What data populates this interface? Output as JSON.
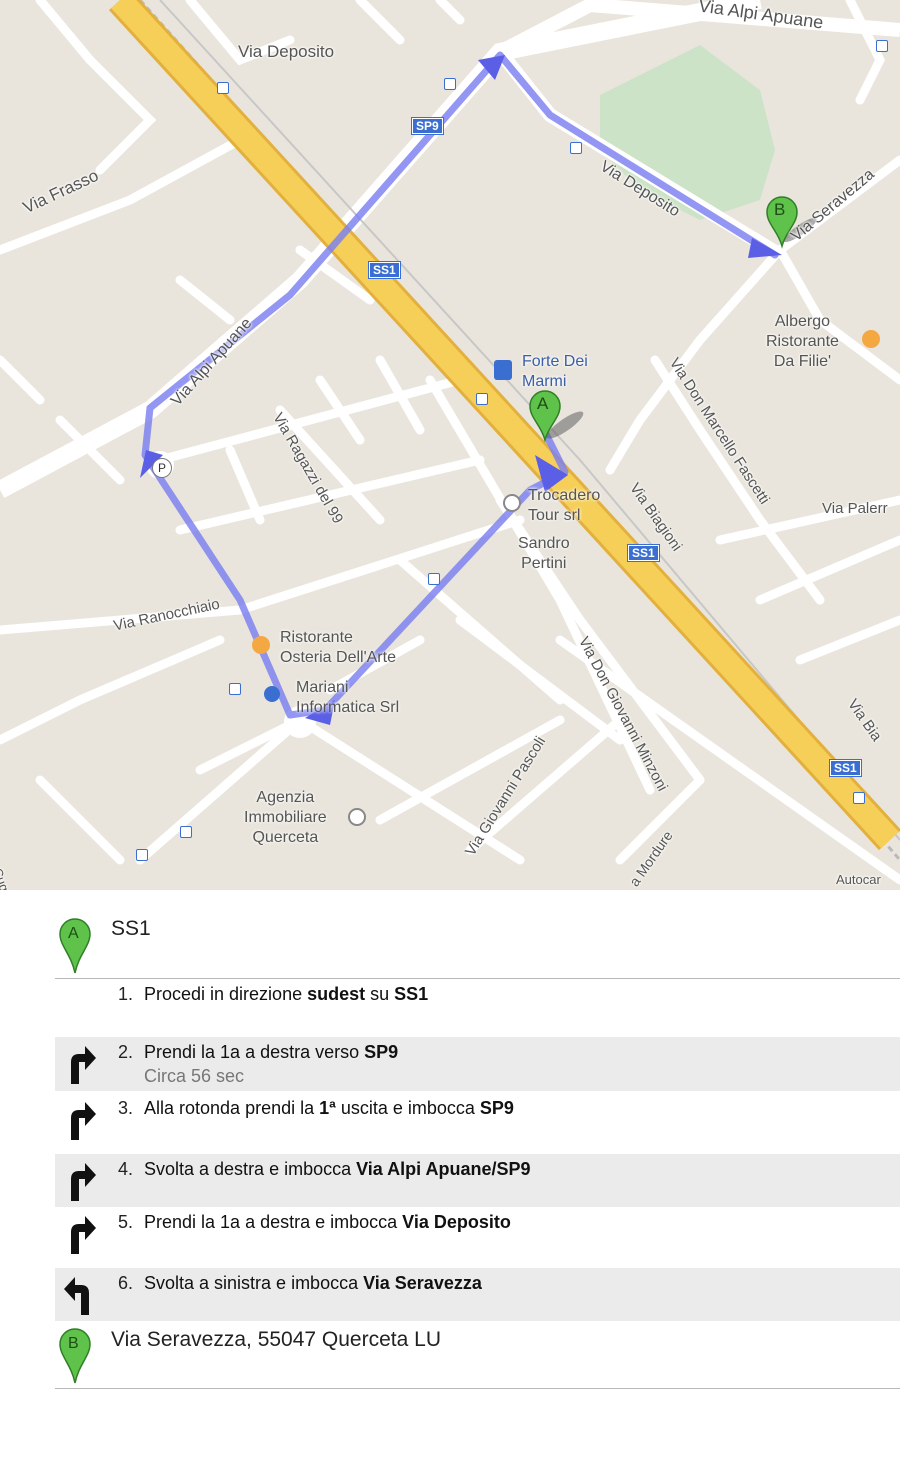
{
  "map": {
    "road_labels": {
      "via_alpi_apuane_top": "Via Alpi Apuane",
      "via_deposito_top": "Via Deposito",
      "via_frasso": "Via Frasso",
      "via_deposito_route": "Via Deposito",
      "via_seravezza": "Via Seravezza",
      "via_alpi_apuane_route": "Via Alpi Apuane",
      "via_ragazzi": "Via Ragazzi del 99",
      "via_don_marcello": "Via Don Marcello Fascetti",
      "via_biagioni": "Via Biagioni",
      "via_palermo": "Via Palerr",
      "via_ranocchiaio": "Via Ranocchiaio",
      "via_don_giovanni": "Via Don Giovanni Minzoni",
      "via_giovanni_pascoli": "Via Giovanni Pascoli",
      "via_biagioni_right": "Via Bia",
      "via_mordure": "a Mordure",
      "cugni": "Cugni",
      "autocar": "Autocar"
    },
    "shields": [
      "SS1",
      "SS1",
      "SS1",
      "SP9"
    ],
    "pois": {
      "forte_dei_marmi": "Forte Dei\nMarmi",
      "albergo": "Albergo\nRistorante\nDa Filie'",
      "trocadero": "Trocadero\nTour srl",
      "sandro_pertini": "Sandro\nPertini",
      "ristorante_osteria": "Ristorante\nOsteria Dell'Arte",
      "mariani": "Mariani\nInformatica Srl",
      "agenzia": "Agenzia\nImmobiliare\nQuerceta"
    },
    "markers": {
      "start": "A",
      "end": "B"
    },
    "colors": {
      "route": "#7b7ff0",
      "highway": "#f6cf59",
      "map_bg": "#e9e5dc",
      "park": "#cde3c8"
    }
  },
  "directions": {
    "start": {
      "marker": "A",
      "title": "SS1"
    },
    "steps": [
      {
        "num": "1.",
        "parts": [
          "Procedi in direzione ",
          "sudest",
          " su ",
          "SS1"
        ],
        "sub": "",
        "turn": "none"
      },
      {
        "num": "2.",
        "parts": [
          "Prendi la 1a a destra verso ",
          "SP9"
        ],
        "sub": "Circa 56 sec",
        "turn": "right"
      },
      {
        "num": "3.",
        "parts": [
          "Alla rotonda prendi la ",
          "1ª",
          " uscita e imbocca ",
          "SP9"
        ],
        "sub": "",
        "turn": "right"
      },
      {
        "num": "4.",
        "parts": [
          "Svolta a destra e imbocca ",
          "Via Alpi Apuane/SP9"
        ],
        "sub": "",
        "turn": "right"
      },
      {
        "num": "5.",
        "parts": [
          "Prendi la 1a a destra e imbocca ",
          "Via Deposito"
        ],
        "sub": "",
        "turn": "right"
      },
      {
        "num": "6.",
        "parts": [
          "Svolta a sinistra e imbocca ",
          "Via Seravezza"
        ],
        "sub": "",
        "turn": "left"
      }
    ],
    "end": {
      "marker": "B",
      "title": "Via Seravezza, 55047 Querceta LU"
    }
  }
}
